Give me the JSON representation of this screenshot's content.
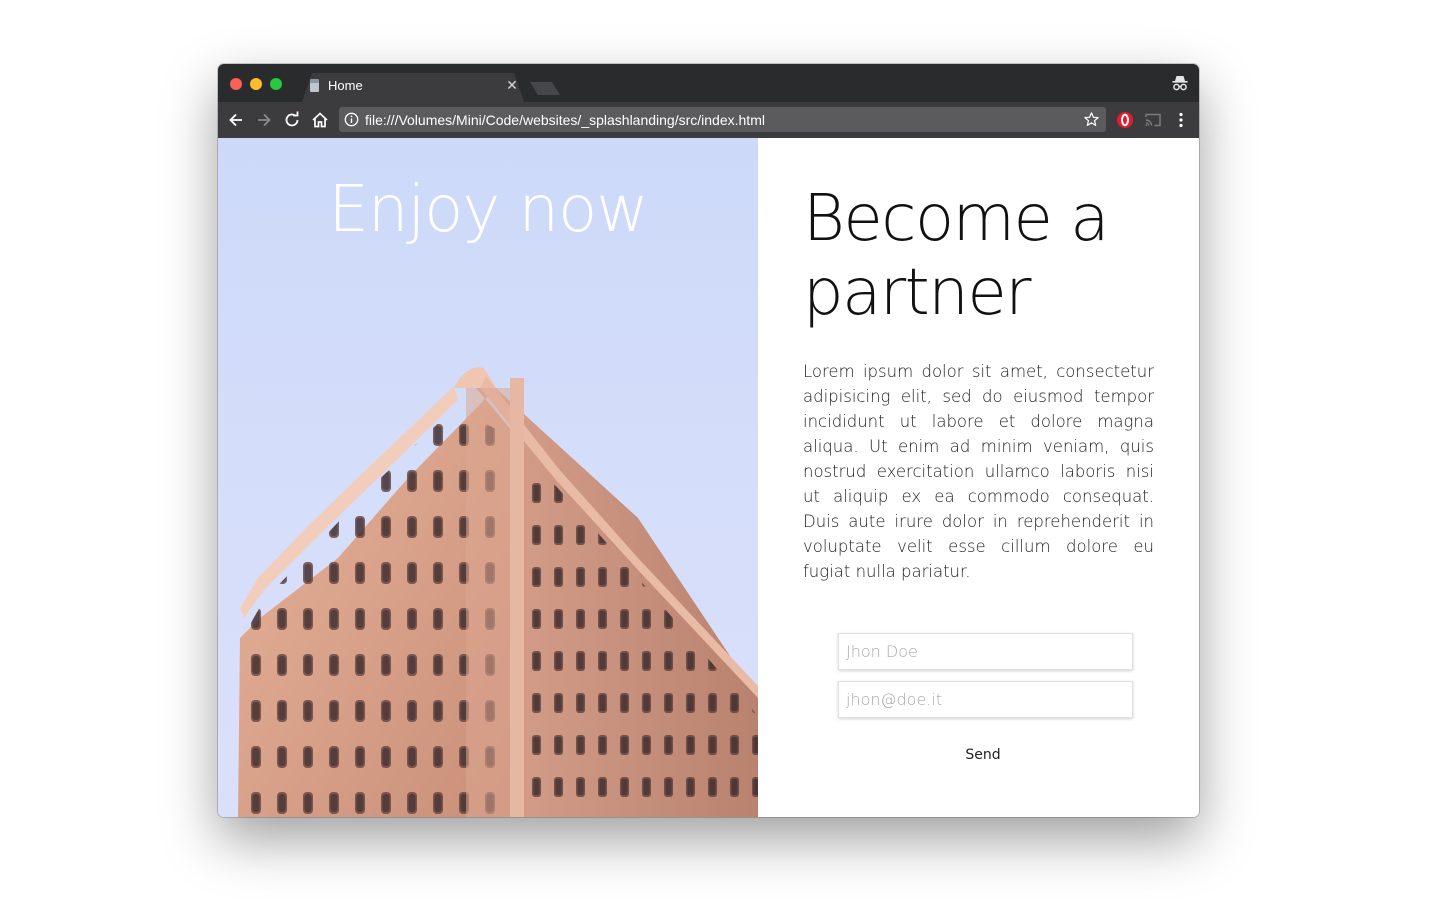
{
  "browser": {
    "tab_title": "Home",
    "tab_close": "✕",
    "url": "file:///Volumes/Mini/Code/websites/_splashlanding/src/index.html"
  },
  "hero": {
    "title": "Enjoy now"
  },
  "partner": {
    "heading": "Become a partner",
    "body": "Lorem ipsum dolor sit amet, consectetur adipisicing elit, sed do eiusmod tempor incididunt ut labore et dolore magna aliqua. Ut enim ad minim veniam, quis nostrud exercitation ullamco laboris nisi ut aliquip ex ea commodo consequat. Duis aute irure dolor in reprehenderit in voluptate velit esse cillum dolore eu fugiat nulla pariatur."
  },
  "form": {
    "name_placeholder": "Jhon Doe",
    "email_placeholder": "jhon@doe.it",
    "send_label": "Send"
  },
  "colors": {
    "chrome_dark": "#2a2b2d",
    "toolbar": "#3c3c3e",
    "sky": "#d3ddfa",
    "building": "#d99a80"
  },
  "icons": [
    "back-icon",
    "forward-icon",
    "reload-icon",
    "home-icon",
    "info-icon",
    "star-icon",
    "opera-icon",
    "cast-icon",
    "menu-icon",
    "incognito-icon",
    "page-favicon",
    "close-icon"
  ]
}
